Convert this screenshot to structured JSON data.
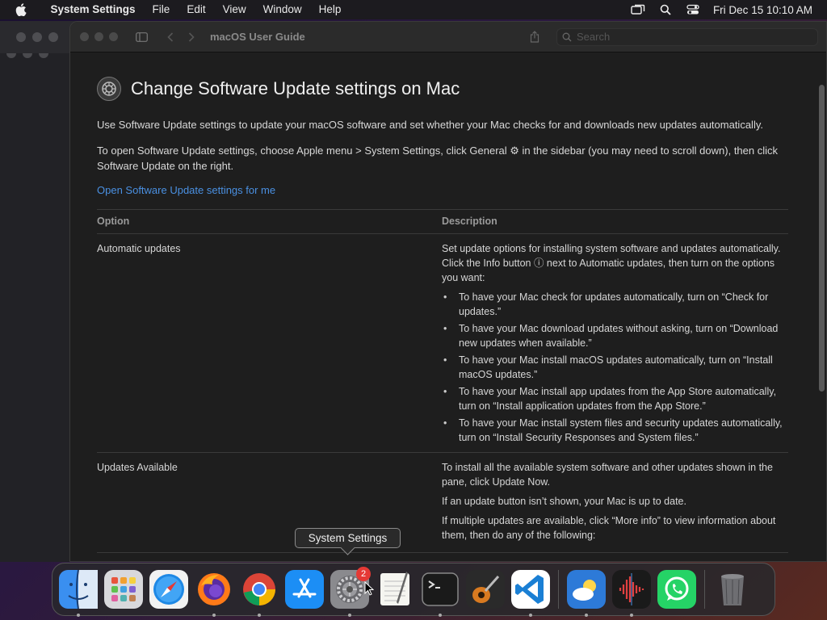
{
  "menubar": {
    "app_name": "System Settings",
    "items": [
      "File",
      "Edit",
      "View",
      "Window",
      "Help"
    ],
    "clock": "Fri Dec 15  10:10 AM"
  },
  "window": {
    "title": "macOS User Guide",
    "search_placeholder": "Search"
  },
  "article": {
    "title": "Change Software Update settings on Mac",
    "intro": "Use Software Update settings to update your macOS software and set whether your Mac checks for and downloads new updates automatically.",
    "open_instructions": "To open Software Update settings, choose Apple menu  > System Settings, click General ⚙ in the sidebar (you may need to scroll down), then click Software Update on the right.",
    "link": "Open Software Update settings for me",
    "table": {
      "headers": [
        "Option",
        "Description"
      ],
      "rows": [
        {
          "option": "Automatic updates",
          "description": "Set update options for installing system software and updates automatically. Click the Info button ⓘ next to Automatic updates, then turn on the options you want:",
          "bullets": [
            "To have your Mac check for updates automatically, turn on “Check for updates.”",
            "To have your Mac download updates without asking, turn on “Download new updates when available.”",
            "To have your Mac install macOS updates automatically, turn on “Install macOS updates.”",
            "To have your Mac install app updates from the App Store automatically, turn on “Install application updates from the App Store.”",
            "To have your Mac install system files and security updates automatically, turn on “Install Security Responses and System files.”"
          ]
        },
        {
          "option": "Updates Available",
          "paragraphs": [
            "To install all the available system software and other updates shown in the pane, click Update Now.",
            "If an update button isn’t shown, your Mac is up to date.",
            "If multiple updates are available, click “More info” to view information about them, then do any of the following:"
          ]
        }
      ]
    }
  },
  "tooltip": "System Settings",
  "dock": {
    "apps": [
      {
        "name": "Finder",
        "icon": "finder-icon"
      },
      {
        "name": "Launchpad",
        "icon": "launchpad-icon"
      },
      {
        "name": "Safari",
        "icon": "safari-icon"
      },
      {
        "name": "Firefox",
        "icon": "firefox-icon"
      },
      {
        "name": "Chrome",
        "icon": "chrome-icon"
      },
      {
        "name": "App Store",
        "icon": "app-store-icon"
      },
      {
        "name": "System Settings",
        "icon": "gear-icon",
        "badge": "2"
      },
      {
        "name": "TextEdit",
        "icon": "textedit-icon"
      },
      {
        "name": "Terminal",
        "icon": "terminal-icon"
      },
      {
        "name": "GarageBand",
        "icon": "guitar-icon"
      },
      {
        "name": "VS Code",
        "icon": "vscode-icon"
      },
      {
        "name": "Weather",
        "icon": "weather-icon"
      },
      {
        "name": "Voice Memos",
        "icon": "waveform-icon"
      },
      {
        "name": "WhatsApp",
        "icon": "whatsapp-icon"
      },
      {
        "name": "Trash",
        "icon": "trash-icon"
      }
    ],
    "system_settings_badge": "2"
  }
}
